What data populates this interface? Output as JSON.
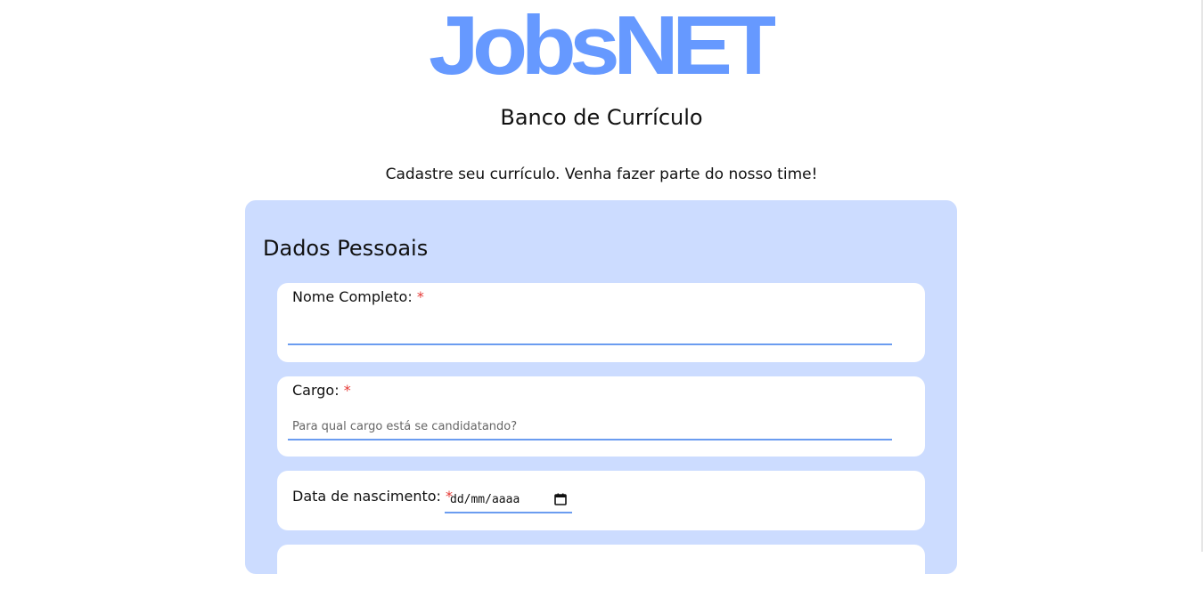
{
  "brand": {
    "logo_text": "JobsNET",
    "logo_color": "#6699ff"
  },
  "header": {
    "subtitle": "Banco de Currículo",
    "tagline": "Cadastre seu currículo. Venha fazer parte do nosso time!"
  },
  "form": {
    "panel_color": "#ccdcff",
    "section_title": "Dados Pessoais",
    "required_mark": "*",
    "fields": {
      "full_name": {
        "label": "Nome Completo:",
        "value": ""
      },
      "position": {
        "label": "Cargo:",
        "placeholder": "Para qual cargo está se candidatando?",
        "value": ""
      },
      "birth_date": {
        "label": "Data de nascimento:",
        "display": "dd/mm/aaaa",
        "icon": "calendar-icon"
      }
    }
  }
}
